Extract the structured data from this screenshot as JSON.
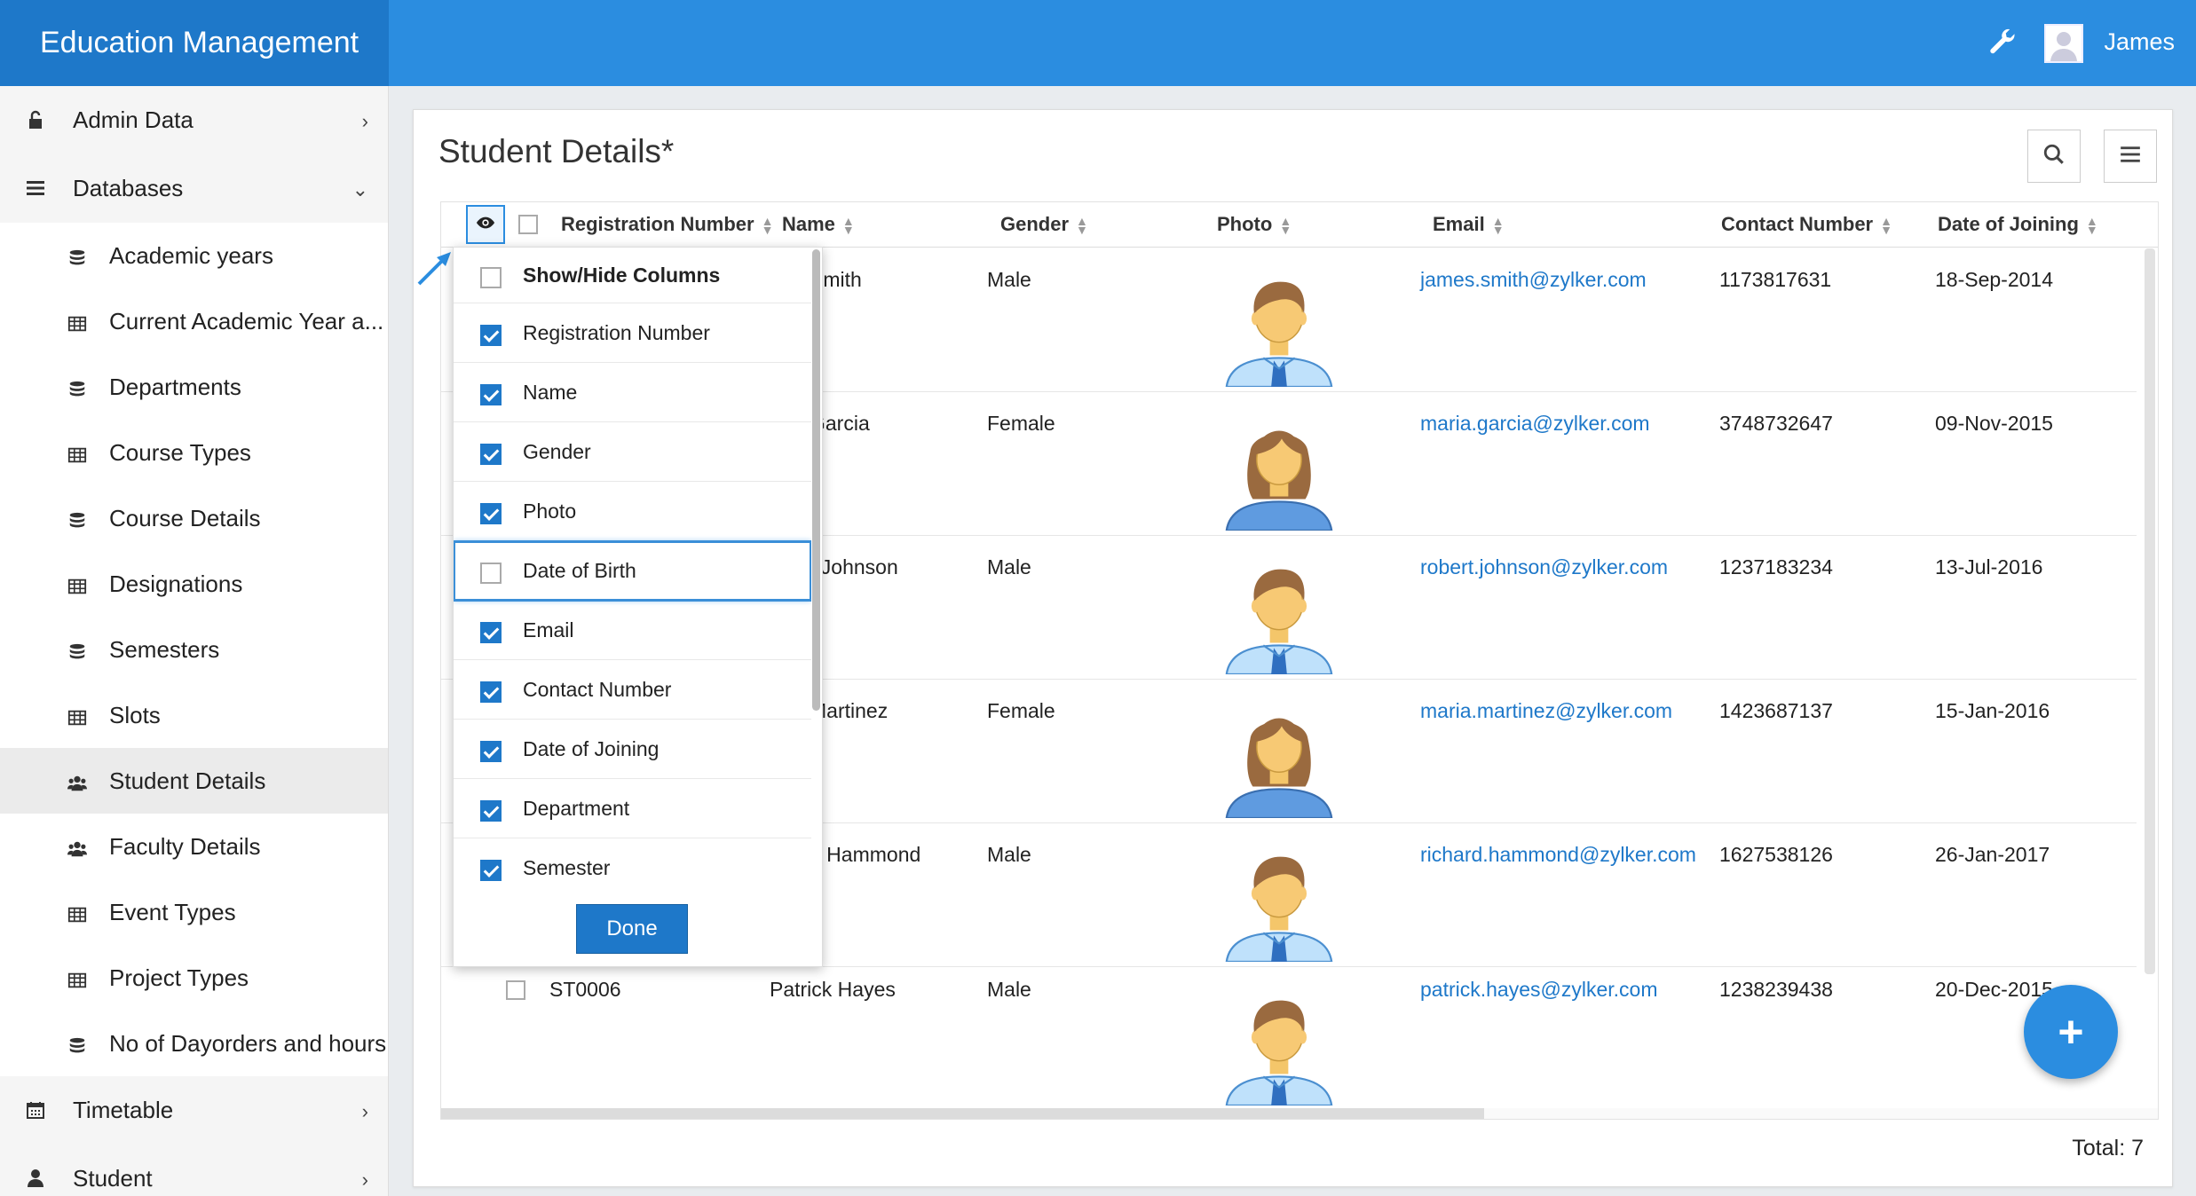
{
  "app": {
    "title": "Education Management",
    "user_name": "James"
  },
  "sidebar": {
    "admin_data": "Admin Data",
    "databases": "Databases",
    "items": [
      {
        "label": "Academic years",
        "icon": "database-icon"
      },
      {
        "label": "Current Academic Year a...",
        "icon": "table-icon"
      },
      {
        "label": "Departments",
        "icon": "database-icon"
      },
      {
        "label": "Course Types",
        "icon": "table-icon"
      },
      {
        "label": "Course Details",
        "icon": "database-icon"
      },
      {
        "label": "Designations",
        "icon": "table-icon"
      },
      {
        "label": "Semesters",
        "icon": "database-icon"
      },
      {
        "label": "Slots",
        "icon": "table-icon"
      },
      {
        "label": "Student Details",
        "icon": "users-icon",
        "active": true
      },
      {
        "label": "Faculty Details",
        "icon": "users-icon"
      },
      {
        "label": "Event Types",
        "icon": "table-icon"
      },
      {
        "label": "Project Types",
        "icon": "table-icon"
      },
      {
        "label": "No of Dayorders and hours",
        "icon": "database-icon"
      }
    ],
    "timetable": "Timetable",
    "student": "Student"
  },
  "main": {
    "title": "Student Details*",
    "total": "Total: 7",
    "columns": [
      "Registration Number",
      "Name",
      "Gender",
      "Photo",
      "Email",
      "Contact Number",
      "Date of Joining"
    ],
    "rows": [
      {
        "reg": "",
        "name": "Smith",
        "gender": "Male",
        "email": "james.smith@zylker.com",
        "contact": "1173817631",
        "doj": "18-Sep-2014",
        "photo": "male"
      },
      {
        "reg": "",
        "name": "Garcia",
        "gender": "Female",
        "email": "maria.garcia@zylker.com",
        "contact": "3748732647",
        "doj": "09-Nov-2015",
        "photo": "female"
      },
      {
        "reg": "",
        "name": "t Johnson",
        "gender": "Male",
        "email": "robert.johnson@zylker.com",
        "contact": "1237183234",
        "doj": "13-Jul-2016",
        "photo": "male"
      },
      {
        "reg": "",
        "name": "Martinez",
        "gender": "Female",
        "email": "maria.martinez@zylker.com",
        "contact": "1423687137",
        "doj": "15-Jan-2016",
        "photo": "female"
      },
      {
        "reg": "",
        "name": "d Hammond",
        "gender": "Male",
        "email": "richard.hammond@zylker.com",
        "contact": "1627538126",
        "doj": "26-Jan-2017",
        "photo": "male"
      },
      {
        "reg": "ST0006",
        "name": "Patrick Hayes",
        "gender": "Male",
        "email": "patrick.hayes@zylker.com",
        "contact": "1238239438",
        "doj": "20-Dec-2015",
        "photo": "male"
      }
    ]
  },
  "popup": {
    "header": "Show/Hide Columns",
    "items": [
      {
        "label": "Registration Number",
        "checked": true
      },
      {
        "label": "Name",
        "checked": true
      },
      {
        "label": "Gender",
        "checked": true
      },
      {
        "label": "Photo",
        "checked": true
      },
      {
        "label": "Date of Birth",
        "checked": false,
        "focused": true
      },
      {
        "label": "Email",
        "checked": true
      },
      {
        "label": "Contact Number",
        "checked": true
      },
      {
        "label": "Date of Joining",
        "checked": true
      },
      {
        "label": "Department",
        "checked": true
      },
      {
        "label": "Semester",
        "checked": true
      }
    ],
    "done": "Done"
  },
  "colors": {
    "header": "#2b8de0",
    "title_bg": "#1e78c9",
    "link": "#1e78c9"
  }
}
